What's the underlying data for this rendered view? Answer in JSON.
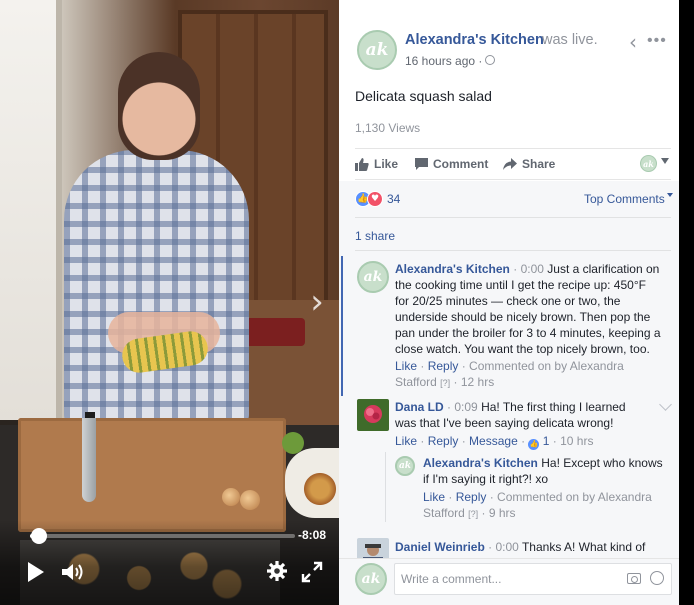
{
  "video": {
    "time_remaining": "-8:08",
    "progress_fraction": 0.035
  },
  "post": {
    "avatar_initials": "ak",
    "page_name": "Alexandra's Kitchen",
    "was_live": "was live.",
    "timestamp": "16 hours ago ·",
    "title": "Delicata squash salad",
    "views": "1,130 Views"
  },
  "actions": {
    "like": "Like",
    "comment": "Comment",
    "share": "Share"
  },
  "feedback": {
    "reaction_count": "34",
    "sort_label": "Top Comments",
    "shares": "1 share"
  },
  "comments": [
    {
      "author": "Alexandra's Kitchen",
      "ts": "· 0:00",
      "text": "Just a clarification on the cooking time until I get the recipe up: 450°F for 20/25 minutes — check one or two, the underside should be nicely brown. Then pop the pan under the broiler for 3 to 4 minutes, keeping a close watch. You want the top nicely brown, too.",
      "like": "Like",
      "reply": "Reply",
      "meta": "· Commented on by Alexandra Stafford",
      "edit": "[?]",
      "age": "· 12 hrs"
    },
    {
      "author": "Dana LD",
      "ts": "· 0:09",
      "text": "Ha! The first thing I learned was that I've been saying delicata wrong!",
      "like": "Like",
      "reply": "Reply",
      "message": "Message",
      "like_count": "1",
      "age": "· 10 hrs"
    },
    {
      "author": "Alexandra's Kitchen",
      "text": "Ha! Except who knows if I'm saying it right?! xo",
      "like": "Like",
      "reply": "Reply",
      "meta": "· Commented on by Alexandra Stafford",
      "edit": "[?]",
      "age": "· 9 hrs"
    },
    {
      "author": "Daniel Weinrieb",
      "ts": "· 0:00",
      "text": "Thanks A! What kind of"
    }
  ],
  "composer": {
    "placeholder": "Write a comment..."
  },
  "colors": {
    "link": "#365899",
    "brand_avatar": "#c8dfcb",
    "like_blue": "#5890ff",
    "love_red": "#f25268"
  }
}
